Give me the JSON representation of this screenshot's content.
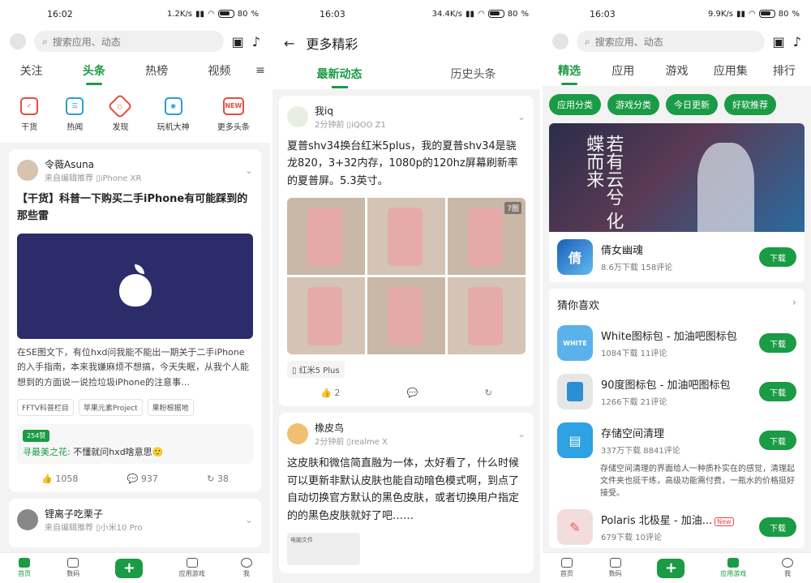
{
  "screen1": {
    "status": {
      "time": "16:02",
      "speed": "1.2K/s",
      "battery": "80"
    },
    "search_placeholder": "搜索应用、动态",
    "tabs": [
      "关注",
      "头条",
      "热榜",
      "视频"
    ],
    "quick_links": [
      {
        "label": "干货",
        "color": "#e74b3c",
        "icon": "check-shield-icon"
      },
      {
        "label": "热闻",
        "color": "#2b9bd6",
        "icon": "document-icon"
      },
      {
        "label": "发现",
        "color": "#e74b3c",
        "icon": "compass-icon"
      },
      {
        "label": "玩机大神",
        "color": "#2b9bd6",
        "icon": "user-icon"
      },
      {
        "label": "更多头条",
        "color": "#e74b3c",
        "icon": "new-badge-icon",
        "badge": "NEW"
      }
    ],
    "post": {
      "author": "令薇Asuna",
      "meta": "来自编辑推荐 ▯iPhone XR",
      "title": "【干货】科普一下购买二手iPhone有可能踩到的那些雷",
      "excerpt": "在SE图文下，有位hxd问我能不能出一期关于二手iPhone的入手指南，本来我嫌麻烦不想搞，今天失眠，从我个人能想到的方面说一说捡垃圾iPhone的注意事…",
      "chips": [
        "FFTV科普栏目",
        "苹果元素Project",
        "果粉根据地"
      ],
      "comment": {
        "likes": "254赞",
        "user": "寻最美之花:",
        "text": "不懂就问hxd啥意思🙂"
      },
      "actions": {
        "likes": "1058",
        "comments": "937",
        "shares": "38"
      }
    },
    "next_author": "锂离子吃栗子",
    "next_meta": "来自编辑推荐 ▯小米10 Pro",
    "nav": [
      "首页",
      "数码",
      "",
      "应用游戏",
      "我"
    ]
  },
  "screen2": {
    "status": {
      "time": "16:03",
      "speed": "34.4K/s",
      "battery": "80"
    },
    "title": "更多精彩",
    "subtabs": [
      "最新动态",
      "历史头条"
    ],
    "post1": {
      "author": "我iq",
      "meta": "2分钟前 ▯iQOO Z1",
      "text": "夏普shv34换台红米5plus，我的夏普shv34是骁龙820，3+32内存，1080p的120hz屏幕刷新率的夏普屏。5.3英寸。",
      "image_count": "7图",
      "topic": "红米5 Plus",
      "likes": "2"
    },
    "post2": {
      "author": "橡皮鸟",
      "meta": "2分钟前 ▯realme X",
      "text": "这皮肤和微信简直融为一体，太好看了，什么时候可以更新非默认皮肤也能自动暗色模式啊，到点了自动切换官方默认的黑色皮肤，或者切换用户指定的的黑色皮肤就好了吧……",
      "preview_text": "电脑文件"
    }
  },
  "screen3": {
    "status": {
      "time": "16:03",
      "speed": "9.9K/s",
      "battery": "80"
    },
    "search_placeholder": "搜索应用、动态",
    "tabs": [
      "精选",
      "应用",
      "游戏",
      "应用集",
      "排行"
    ],
    "pills": [
      "应用分类",
      "游戏分类",
      "今日更新",
      "好软推荐"
    ],
    "banner": {
      "title": "若有云兮 化蝶而来"
    },
    "featured": {
      "name": "倩女幽魂",
      "downloads": "8.6万下载",
      "comments": "158评论",
      "button": "下载"
    },
    "section_title": "猜你喜欢",
    "apps": [
      {
        "name": "White图标包 - 加油吧图标包",
        "downloads": "1084下载",
        "comments": "11评论",
        "button": "下载",
        "color": "#4fb0e8",
        "icon_text": "WHITE"
      },
      {
        "name": "90度图标包 - 加油吧图标包",
        "downloads": "1266下载",
        "comments": "21评论",
        "button": "下载",
        "color": "#2b8fd6",
        "icon_text": ""
      },
      {
        "name": "存储空间清理",
        "downloads": "337万下载",
        "comments": "8841评论",
        "button": "下载",
        "color": "#2ea2e3",
        "icon_text": "",
        "desc": "存储空间清理的界面给人一种质朴实在的感觉，清理起文件夹也挺干练，高级功能需付费，一瓶水的价格挺好接受。"
      },
      {
        "name": "Polaris 北极星 - 加油...",
        "downloads": "679下载",
        "comments": "10评论",
        "button": "下载",
        "color": "#e85858",
        "icon_text": "",
        "tag": "New"
      }
    ],
    "nav": [
      "首页",
      "数码",
      "",
      "应用游戏",
      "我"
    ]
  }
}
